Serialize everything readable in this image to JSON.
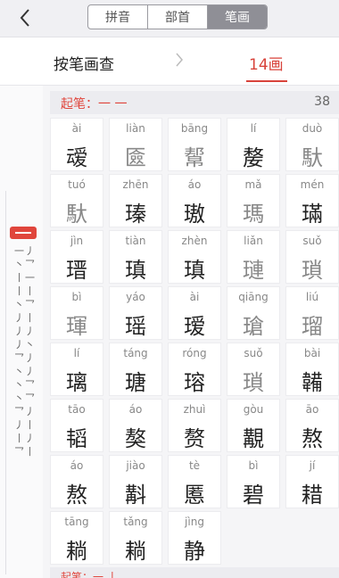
{
  "tabs": [
    "拼音",
    "部首",
    "笔画"
  ],
  "subheader": {
    "left_label": "按笔画查",
    "right_label": "14画"
  },
  "rail": {
    "items": [
      "一丿",
      "丶乛",
      "丨一",
      "丨丨",
      "丶乛",
      "丿丨",
      "丿丿",
      "丿丶",
      "乛丿",
      "丶丿",
      "丶乛",
      "丶乛",
      "乛丿",
      "丿丨",
      "丨丿",
      "乛丨"
    ]
  },
  "section": {
    "title": "起笔：一 一",
    "count": "38"
  },
  "cells": [
    {
      "py": "ài",
      "hz": "叆",
      "light": false
    },
    {
      "py": "liàn",
      "hz": "匳",
      "light": true
    },
    {
      "py": "bāng",
      "hz": "幚",
      "light": true
    },
    {
      "py": "lí",
      "hz": "嫠",
      "light": false
    },
    {
      "py": "duò",
      "hz": "馱",
      "light": true
    },
    {
      "py": "tuó",
      "hz": "馱",
      "light": true
    },
    {
      "py": "zhēn",
      "hz": "瑧",
      "light": false
    },
    {
      "py": "áo",
      "hz": "璈",
      "light": false
    },
    {
      "py": "mǎ",
      "hz": "瑪",
      "light": true
    },
    {
      "py": "mén",
      "hz": "璊",
      "light": false
    },
    {
      "py": "jìn",
      "hz": "瑨",
      "light": false
    },
    {
      "py": "tiàn",
      "hz": "瑱",
      "light": false
    },
    {
      "py": "zhèn",
      "hz": "瑱",
      "light": false
    },
    {
      "py": "liǎn",
      "hz": "璉",
      "light": true
    },
    {
      "py": "suǒ",
      "hz": "瑣",
      "light": true
    },
    {
      "py": "bì",
      "hz": "琿",
      "light": true
    },
    {
      "py": "yáo",
      "hz": "瑶",
      "light": false
    },
    {
      "py": "ài",
      "hz": "瑷",
      "light": false
    },
    {
      "py": "qiāng",
      "hz": "瑲",
      "light": true
    },
    {
      "py": "liú",
      "hz": "瑠",
      "light": true
    },
    {
      "py": "lí",
      "hz": "璃",
      "light": false
    },
    {
      "py": "táng",
      "hz": "瑭",
      "light": false
    },
    {
      "py": "róng",
      "hz": "瑢",
      "light": false
    },
    {
      "py": "suǒ",
      "hz": "瑣",
      "light": true
    },
    {
      "py": "bài",
      "hz": "韛",
      "light": false
    },
    {
      "py": "tāo",
      "hz": "韬",
      "light": false
    },
    {
      "py": "áo",
      "hz": "獒",
      "light": false
    },
    {
      "py": "zhuì",
      "hz": "赘",
      "light": false
    },
    {
      "py": "gòu",
      "hz": "覯",
      "light": false
    },
    {
      "py": "āo",
      "hz": "熬",
      "light": false
    },
    {
      "py": "áo",
      "hz": "熬",
      "light": false
    },
    {
      "py": "jiào",
      "hz": "斠",
      "light": false
    },
    {
      "py": "tè",
      "hz": "慝",
      "light": false
    },
    {
      "py": "bì",
      "hz": "碧",
      "light": false
    },
    {
      "py": "jí",
      "hz": "耤",
      "light": false
    },
    {
      "py": "tāng",
      "hz": "耥",
      "light": false
    },
    {
      "py": "tǎng",
      "hz": "耥",
      "light": false
    },
    {
      "py": "jìng",
      "hz": "静",
      "light": false
    }
  ],
  "next_section": {
    "title": "起笔：一 丨"
  }
}
